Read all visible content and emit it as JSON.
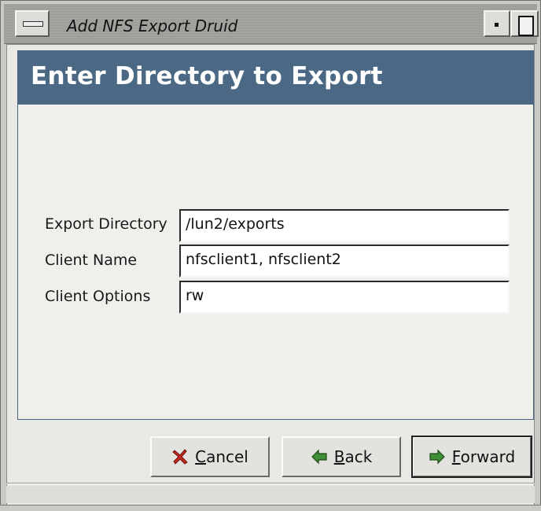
{
  "window": {
    "title": "Add NFS Export Druid"
  },
  "banner": {
    "heading": "Enter Directory to Export"
  },
  "form": {
    "export_directory_label": "Export Directory",
    "export_directory_value": "/lun2/exports",
    "client_name_label": "Client Name",
    "client_name_value": "nfsclient1, nfsclient2",
    "client_options_label": "Client Options",
    "client_options_value": "rw"
  },
  "buttons": {
    "cancel": {
      "mnemonic": "C",
      "rest": "ancel",
      "icon": "cancel-x-icon"
    },
    "back": {
      "mnemonic": "B",
      "rest": "ack",
      "icon": "arrow-left-icon"
    },
    "forward": {
      "mnemonic": "F",
      "rest": "orward",
      "icon": "arrow-right-icon"
    }
  },
  "colors": {
    "banner_bg": "#4b6985",
    "banner_text": "#ffffff",
    "panel_bg": "#f0efec",
    "cancel_icon": "#c8281e",
    "arrow_icon": "#2f7a2a"
  }
}
